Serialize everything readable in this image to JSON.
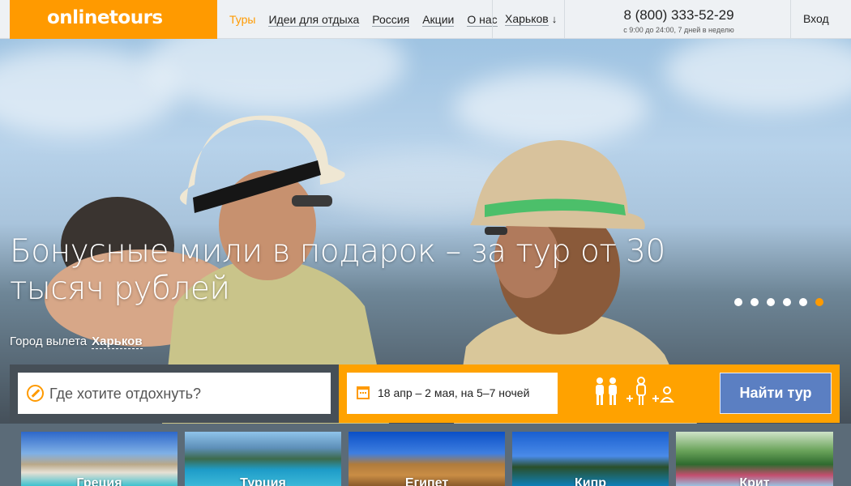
{
  "header": {
    "logo": "onlinetours",
    "nav": [
      {
        "label": "Туры",
        "active": true
      },
      {
        "label": "Идеи для отдыха",
        "active": false
      },
      {
        "label": "Россия",
        "active": false
      },
      {
        "label": "Акции",
        "active": false
      },
      {
        "label": "О нас",
        "active": false
      }
    ],
    "city": "Харьков",
    "city_arrow": "↓",
    "phone": "8 (800) 333-52-29",
    "phone_hours": "с 9:00 до 24:00, 7 дней в неделю",
    "login": "Вход"
  },
  "hero": {
    "title": "Бонусные мили в подарок – за тур от 30 тысяч рублей",
    "slides_count": 6,
    "active_slide": 6,
    "departure_label": "Город вылета",
    "departure_city": "Харьков"
  },
  "search": {
    "destination_placeholder": "Где хотите отдохнуть?",
    "dates": "18 апр – 2 мая, на 5–7 ночей",
    "find_button": "Найти тур"
  },
  "tiles": [
    {
      "label": "Греция"
    },
    {
      "label": "Турция"
    },
    {
      "label": "Египет"
    },
    {
      "label": "Кипр"
    },
    {
      "label": "Крит"
    }
  ],
  "colors": {
    "brand_orange": "#ff9a00",
    "button_blue": "#5b7fc2"
  },
  "icons": [
    "compass-icon",
    "calendar-icon",
    "adults-icon",
    "child-icon",
    "infant-icon"
  ]
}
